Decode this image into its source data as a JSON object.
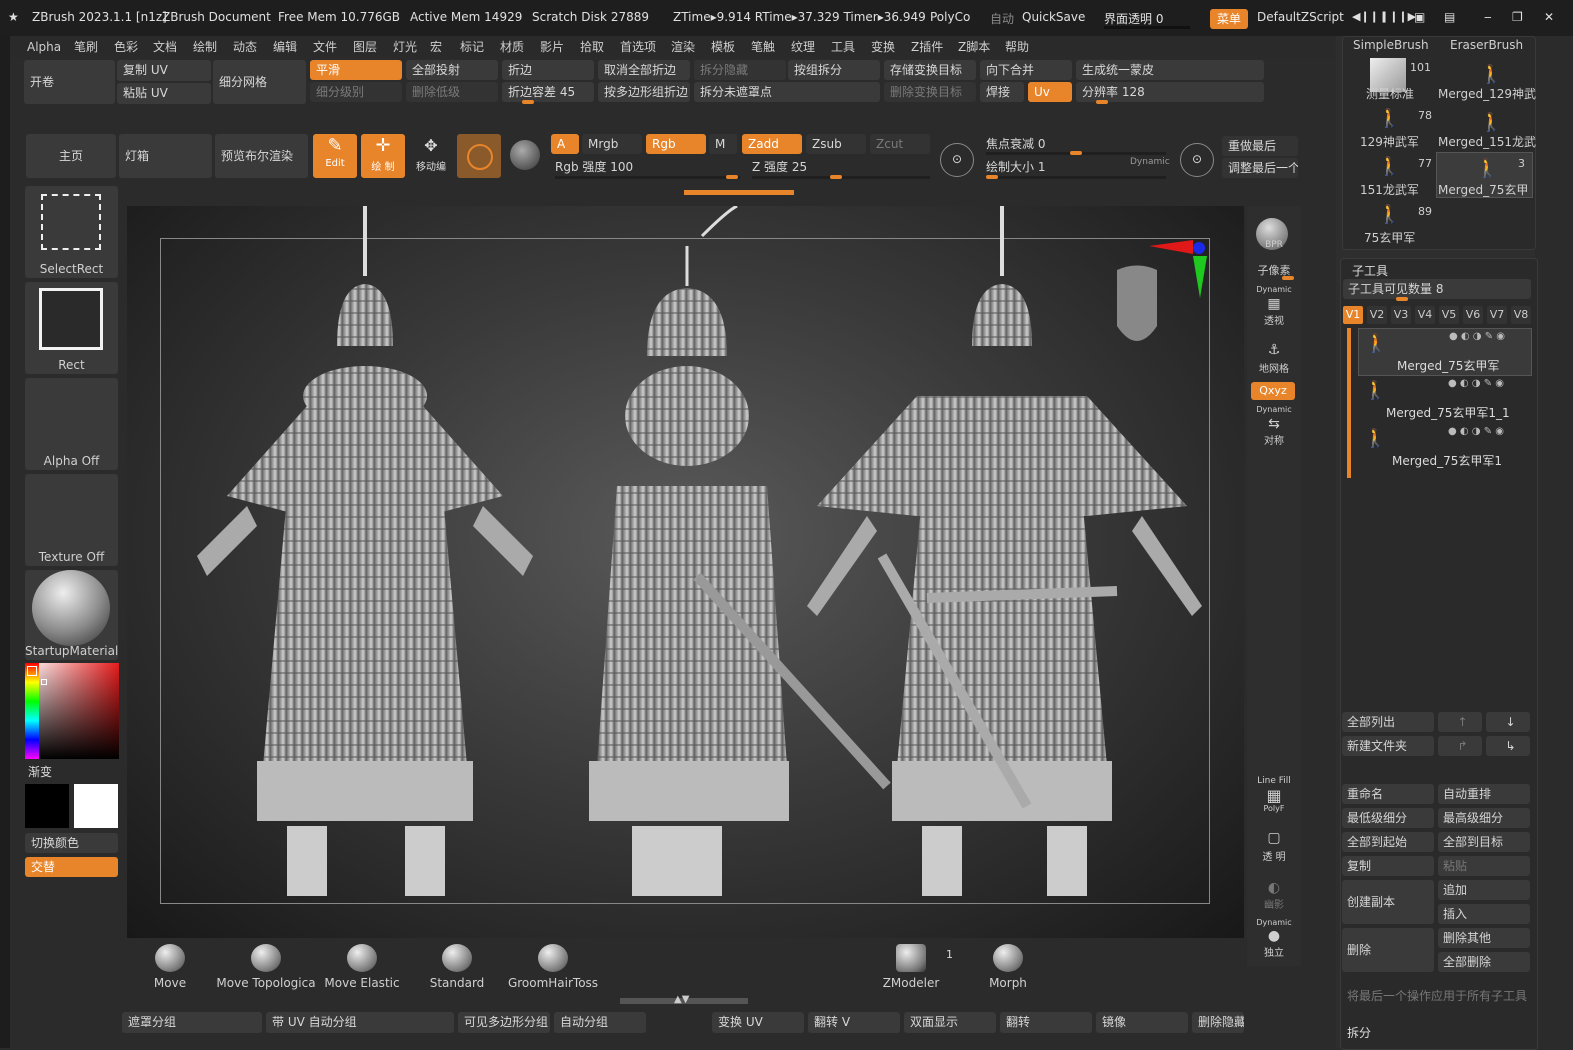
{
  "titlebar": {
    "app": "ZBrush 2023.1.1 [n1z]",
    "doc": "ZBrush Document",
    "free_mem": "Free Mem 10.776GB",
    "active_mem": "Active Mem 14929",
    "scratch": "Scratch Disk 27889",
    "ztime": "ZTime▸9.914 RTime▸37.329 Timer▸36.949",
    "polyco": "PolyCo",
    "auto": "自动",
    "quicksave": "QuickSave",
    "transparency": "界面透明 0",
    "menu": "菜单",
    "script": "DefaultZScript"
  },
  "menubar": [
    "Alpha",
    "笔刷",
    "色彩",
    "文档",
    "绘制",
    "动态",
    "编辑",
    "文件",
    "图层",
    "灯光",
    "宏",
    "标记",
    "材质",
    "影片",
    "拾取",
    "首选项",
    "渲染",
    "模板",
    "笔触",
    "纹理",
    "工具",
    "变换",
    "Z插件",
    "Z脚本",
    "帮助"
  ],
  "uvrow": {
    "open": "开卷",
    "copy_uv": "复制 UV",
    "paste_uv": "粘贴 UV",
    "subdiv": "细分网格",
    "smooth": "平滑",
    "subdiv_level": "细分级别",
    "project_all": "全部投射",
    "del_lower": "删除低级",
    "crease": "折边",
    "crease_tol": "折边容差 45",
    "uncrease_all": "取消全部折边",
    "crease_pg": "按多边形组折边",
    "split_hidden": "拆分隐藏",
    "split_unmasked": "拆分未遮罩点",
    "groups_split": "按组拆分",
    "store_morph": "存储变换目标",
    "del_morph": "删除变换目标",
    "merge_down": "向下合并",
    "weld": "焊接",
    "uv": "Uv",
    "unified_skin": "生成统一蒙皮",
    "resolution": "分辨率 128"
  },
  "toolbar": {
    "home": "主页",
    "lightbox": "灯箱",
    "preview_bool": "预览布尔渲染",
    "edit": "Edit",
    "draw": "绘 制",
    "move": "移动编",
    "a": "A",
    "mrgb": "Mrgb",
    "rgb": "Rgb",
    "m": "M",
    "zadd": "Zadd",
    "zsub": "Zsub",
    "zcut": "Zcut",
    "rgb_intensity": "Rgb 强度 100",
    "z_intensity": "Z 强度 25",
    "focal": "焦点衰减 0",
    "draw_size": "绘制大小 1",
    "dynamic": "Dynamic",
    "redo_last": "重做最后",
    "adjust_last": "调整最后一个"
  },
  "leftshelf": {
    "selectrect": "SelectRect",
    "rect": "Rect",
    "alpha_off": "Alpha Off",
    "texture_off": "Texture Off",
    "material": "StartupMaterial",
    "gradient": "渐变",
    "switch_color": "切换颜色",
    "alternate": "交替"
  },
  "rightshelf": {
    "bpr": "BPR",
    "subpixel": "子像素",
    "dynamic": "Dynamic",
    "persp": "透视",
    "floor": "地网格",
    "xyz": "Qxyz",
    "symmetry": "对称",
    "linefill": "Line Fill",
    "polyf": "PolyF",
    "transp": "透 明",
    "ghost": "幽影",
    "solo": "独立"
  },
  "tools": [
    {
      "name": "SimpleBrush",
      "count": ""
    },
    {
      "name": "EraserBrush",
      "count": ""
    },
    {
      "name": "测量标准",
      "count": "101"
    },
    {
      "name": "Merged_129神武",
      "count": ""
    },
    {
      "name": "129神武军",
      "count": "78"
    },
    {
      "name": "Merged_151龙武",
      "count": ""
    },
    {
      "name": "151龙武军",
      "count": "77"
    },
    {
      "name": "Merged_75玄甲",
      "count": "3"
    },
    {
      "name": "75玄甲军",
      "count": "89"
    }
  ],
  "subtool": {
    "title": "子工具",
    "visible": "子工具可见数量 8",
    "tabs": [
      "V1",
      "V2",
      "V3",
      "V4",
      "V5",
      "V6",
      "V7",
      "V8"
    ],
    "items": [
      "Merged_75玄甲军",
      "Merged_75玄甲军1_1",
      "Merged_75玄甲军1"
    ],
    "list_all": "全部列出",
    "new_folder": "新建文件夹",
    "rename": "重命名",
    "auto_reorder": "自动重排",
    "lowest": "最低级细分",
    "highest": "最高级细分",
    "all_to_start": "全部到起始",
    "all_to_target": "全部到目标",
    "duplicate": "复制",
    "paste": "粘贴",
    "create_copy": "创建副本",
    "append": "追加",
    "insert": "插入",
    "delete": "删除",
    "delete_other": "删除其他",
    "delete_all": "全部删除",
    "apply_all": "将最后一个操作应用于所有子工具",
    "split": "拆分"
  },
  "brushes": [
    "Move",
    "Move Topologica",
    "Move Elastic",
    "Standard",
    "GroomHairToss",
    "ZModeler",
    "Morph"
  ],
  "zmodeler_count": "1",
  "bottombar": [
    "遮罩分组",
    "带 UV 自动分组",
    "可见多边形分组",
    "自动分组",
    "变换 UV",
    "翻转 V",
    "双面显示",
    "翻转",
    "镜像",
    "删除隐藏"
  ],
  "colors": {
    "accent": "#e8852b",
    "bg": "#2b2b2b",
    "panel": "#3a3a3a"
  }
}
